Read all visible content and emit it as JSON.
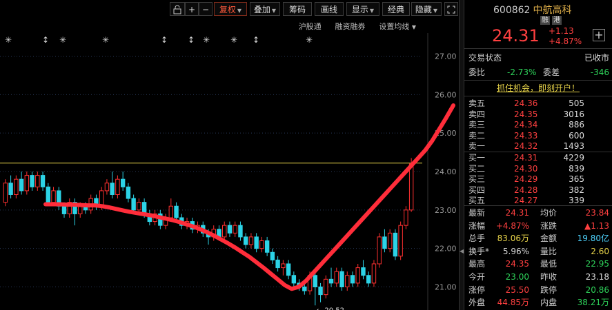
{
  "toolbar": {
    "lock_icon": "lock-icon",
    "zoom_in": "+",
    "zoom_out": "−",
    "fuquan": "复权",
    "diejia": "叠加",
    "chouma": "筹码",
    "huaxian": "画线",
    "xianshi": "显示",
    "jingdian": "经典",
    "yincang": "隐藏",
    "fullscreen_icon": "fullscreen-icon"
  },
  "subbar": {
    "hgt": "沪股通",
    "rzrq": "融资融券",
    "settings": "设置均线"
  },
  "chart_data": {
    "type": "candlestick",
    "y_axis_ticks": [
      "27.00",
      "26.00",
      "25.00",
      "24.00",
      "23.00",
      "22.00",
      "21.00"
    ],
    "ylim": [
      20.4,
      27.6
    ],
    "ref_line": 24.22,
    "low_marker": "20.52",
    "event_marker_types": [
      "star",
      "arrow",
      "star",
      "star",
      "arrow",
      "arrow",
      "star",
      "star",
      "arrow",
      "star"
    ],
    "candles": [
      {
        "o": 23.2,
        "c": 23.7,
        "h": 23.8,
        "l": 23.1
      },
      {
        "o": 23.7,
        "c": 23.4,
        "h": 23.9,
        "l": 23.3
      },
      {
        "o": 23.4,
        "c": 23.8,
        "h": 23.9,
        "l": 23.3
      },
      {
        "o": 23.8,
        "c": 23.5,
        "h": 24.0,
        "l": 23.4
      },
      {
        "o": 23.5,
        "c": 23.9,
        "h": 24.0,
        "l": 23.4
      },
      {
        "o": 23.9,
        "c": 23.6,
        "h": 24.0,
        "l": 23.5
      },
      {
        "o": 23.6,
        "c": 23.9,
        "h": 24.0,
        "l": 23.5
      },
      {
        "o": 23.9,
        "c": 23.6,
        "h": 24.0,
        "l": 23.5
      },
      {
        "o": 23.6,
        "c": 23.2,
        "h": 23.7,
        "l": 23.1
      },
      {
        "o": 23.2,
        "c": 23.5,
        "h": 23.6,
        "l": 23.1
      },
      {
        "o": 23.5,
        "c": 23.1,
        "h": 23.6,
        "l": 23.0
      },
      {
        "o": 23.1,
        "c": 22.9,
        "h": 23.2,
        "l": 22.8
      },
      {
        "o": 22.9,
        "c": 23.2,
        "h": 23.3,
        "l": 22.8
      },
      {
        "o": 23.2,
        "c": 22.9,
        "h": 23.3,
        "l": 22.6
      },
      {
        "o": 22.9,
        "c": 23.1,
        "h": 23.2,
        "l": 22.8
      },
      {
        "o": 23.1,
        "c": 23.0,
        "h": 23.2,
        "l": 22.9
      },
      {
        "o": 23.0,
        "c": 23.3,
        "h": 23.4,
        "l": 22.9
      },
      {
        "o": 23.3,
        "c": 23.1,
        "h": 23.4,
        "l": 23.0
      },
      {
        "o": 23.1,
        "c": 23.5,
        "h": 23.6,
        "l": 23.0
      },
      {
        "o": 23.5,
        "c": 23.7,
        "h": 23.8,
        "l": 23.4
      },
      {
        "o": 23.7,
        "c": 23.4,
        "h": 24.0,
        "l": 23.3
      },
      {
        "o": 23.4,
        "c": 23.8,
        "h": 23.9,
        "l": 23.3
      },
      {
        "o": 23.8,
        "c": 23.6,
        "h": 24.0,
        "l": 23.5
      },
      {
        "o": 23.6,
        "c": 23.3,
        "h": 23.7,
        "l": 23.2
      },
      {
        "o": 23.3,
        "c": 23.0,
        "h": 23.4,
        "l": 22.9
      },
      {
        "o": 23.0,
        "c": 23.2,
        "h": 23.3,
        "l": 22.9
      },
      {
        "o": 23.2,
        "c": 22.9,
        "h": 23.3,
        "l": 22.8
      },
      {
        "o": 22.9,
        "c": 22.7,
        "h": 23.0,
        "l": 22.6
      },
      {
        "o": 22.7,
        "c": 22.9,
        "h": 23.0,
        "l": 22.6
      },
      {
        "o": 22.9,
        "c": 22.6,
        "h": 23.0,
        "l": 22.5
      },
      {
        "o": 22.6,
        "c": 22.8,
        "h": 22.9,
        "l": 22.5
      },
      {
        "o": 22.8,
        "c": 23.1,
        "h": 23.3,
        "l": 22.7
      },
      {
        "o": 23.1,
        "c": 22.8,
        "h": 23.2,
        "l": 22.7
      },
      {
        "o": 22.8,
        "c": 22.6,
        "h": 22.9,
        "l": 22.5
      },
      {
        "o": 22.6,
        "c": 22.7,
        "h": 22.8,
        "l": 22.5
      },
      {
        "o": 22.7,
        "c": 22.5,
        "h": 22.8,
        "l": 22.4
      },
      {
        "o": 22.5,
        "c": 22.6,
        "h": 22.7,
        "l": 22.4
      },
      {
        "o": 22.6,
        "c": 22.4,
        "h": 22.7,
        "l": 22.3
      },
      {
        "o": 22.4,
        "c": 22.3,
        "h": 22.5,
        "l": 22.1
      },
      {
        "o": 22.3,
        "c": 22.5,
        "h": 22.6,
        "l": 22.2
      },
      {
        "o": 22.5,
        "c": 22.3,
        "h": 22.6,
        "l": 22.2
      },
      {
        "o": 22.3,
        "c": 22.6,
        "h": 22.7,
        "l": 22.2
      },
      {
        "o": 22.6,
        "c": 22.4,
        "h": 22.7,
        "l": 22.3
      },
      {
        "o": 22.4,
        "c": 22.6,
        "h": 22.7,
        "l": 22.3
      },
      {
        "o": 22.6,
        "c": 22.3,
        "h": 22.7,
        "l": 22.2
      },
      {
        "o": 22.3,
        "c": 22.1,
        "h": 22.4,
        "l": 22.0
      },
      {
        "o": 22.1,
        "c": 22.3,
        "h": 22.4,
        "l": 22.0
      },
      {
        "o": 22.3,
        "c": 22.0,
        "h": 22.4,
        "l": 21.9
      },
      {
        "o": 22.0,
        "c": 22.2,
        "h": 22.3,
        "l": 21.9
      },
      {
        "o": 22.2,
        "c": 21.9,
        "h": 22.3,
        "l": 21.8
      },
      {
        "o": 21.9,
        "c": 21.7,
        "h": 22.0,
        "l": 21.6
      },
      {
        "o": 21.7,
        "c": 21.5,
        "h": 21.8,
        "l": 21.4
      },
      {
        "o": 21.5,
        "c": 21.6,
        "h": 21.7,
        "l": 21.3
      },
      {
        "o": 21.6,
        "c": 21.3,
        "h": 21.7,
        "l": 21.2
      },
      {
        "o": 21.3,
        "c": 21.1,
        "h": 21.4,
        "l": 21.0
      },
      {
        "o": 21.1,
        "c": 21.0,
        "h": 21.2,
        "l": 20.9
      },
      {
        "o": 21.0,
        "c": 20.9,
        "h": 21.1,
        "l": 20.8
      },
      {
        "o": 20.9,
        "c": 21.3,
        "h": 21.4,
        "l": 20.8
      },
      {
        "o": 21.3,
        "c": 21.0,
        "h": 21.4,
        "l": 20.52
      },
      {
        "o": 21.0,
        "c": 20.8,
        "h": 21.1,
        "l": 20.6
      },
      {
        "o": 20.8,
        "c": 21.2,
        "h": 21.3,
        "l": 20.7
      },
      {
        "o": 21.2,
        "c": 21.1,
        "h": 21.5,
        "l": 21.0
      },
      {
        "o": 21.1,
        "c": 21.4,
        "h": 21.5,
        "l": 21.0
      },
      {
        "o": 21.4,
        "c": 21.0,
        "h": 21.5,
        "l": 20.9
      },
      {
        "o": 21.0,
        "c": 21.3,
        "h": 21.4,
        "l": 20.9
      },
      {
        "o": 21.3,
        "c": 21.1,
        "h": 21.4,
        "l": 21.0
      },
      {
        "o": 21.1,
        "c": 21.5,
        "h": 21.6,
        "l": 21.0
      },
      {
        "o": 21.5,
        "c": 21.3,
        "h": 21.7,
        "l": 21.2
      },
      {
        "o": 21.3,
        "c": 21.1,
        "h": 21.4,
        "l": 21.0
      },
      {
        "o": 21.1,
        "c": 21.6,
        "h": 21.7,
        "l": 21.0
      },
      {
        "o": 21.6,
        "c": 22.3,
        "h": 22.4,
        "l": 21.5
      },
      {
        "o": 22.3,
        "c": 22.0,
        "h": 22.5,
        "l": 21.9
      },
      {
        "o": 22.0,
        "c": 22.4,
        "h": 22.5,
        "l": 21.9
      },
      {
        "o": 22.4,
        "c": 21.8,
        "h": 22.5,
        "l": 21.7
      },
      {
        "o": 21.8,
        "c": 22.6,
        "h": 22.7,
        "l": 21.7
      },
      {
        "o": 22.6,
        "c": 23.0,
        "h": 23.1,
        "l": 22.5
      },
      {
        "o": 23.0,
        "c": 24.2,
        "h": 24.35,
        "l": 22.95
      }
    ],
    "ma_line": [
      23.15,
      23.15,
      23.15,
      23.14,
      23.14,
      23.13,
      23.12,
      23.12,
      23.1,
      23.07,
      23.03,
      22.99,
      22.95,
      22.92,
      22.89,
      22.86,
      22.82,
      22.78,
      22.74,
      22.69,
      22.63,
      22.57,
      22.5,
      22.42,
      22.33,
      22.23,
      22.13,
      22.02,
      21.9,
      21.78,
      21.64,
      21.5,
      21.35,
      21.2,
      21.05,
      20.95,
      21.0,
      21.15,
      21.35,
      21.55,
      21.75,
      21.95,
      22.15,
      22.35,
      22.55,
      22.75,
      22.95,
      23.15,
      23.35,
      23.55,
      23.75,
      23.95,
      24.15,
      24.35,
      24.55,
      24.8,
      25.1,
      25.4,
      25.72
    ]
  },
  "panel": {
    "code": "600862",
    "name": "中航高科",
    "badge1": "融",
    "badge2": "港",
    "plus": "+",
    "price": "24.31",
    "change": "+1.13",
    "change_pct": "+4.87%",
    "trade_status_label": "交易状态",
    "trade_status": "已收市",
    "weibi_label": "委比",
    "weibi": "-2.73%",
    "weicha_label": "委差",
    "weicha": "-346",
    "promo": "抓住机会，即刻开户！",
    "sells": [
      {
        "label": "卖五",
        "price": "24.36",
        "vol": "505"
      },
      {
        "label": "卖四",
        "price": "24.35",
        "vol": "3016"
      },
      {
        "label": "卖三",
        "price": "24.34",
        "vol": "886"
      },
      {
        "label": "卖二",
        "price": "24.33",
        "vol": "600"
      },
      {
        "label": "卖一",
        "price": "24.32",
        "vol": "1493"
      }
    ],
    "buys": [
      {
        "label": "买一",
        "price": "24.31",
        "vol": "4229"
      },
      {
        "label": "买二",
        "price": "24.30",
        "vol": "839"
      },
      {
        "label": "买三",
        "price": "24.29",
        "vol": "365"
      },
      {
        "label": "买四",
        "price": "24.28",
        "vol": "382"
      },
      {
        "label": "买五",
        "price": "24.27",
        "vol": "339"
      }
    ],
    "stats": [
      {
        "l1": "最新",
        "v1": "24.31",
        "c1": "red",
        "l2": "均价",
        "v2": "23.84",
        "c2": "red"
      },
      {
        "l1": "涨幅",
        "v1": "+4.87%",
        "c1": "red",
        "l2": "涨跌",
        "v2": "▲1.13",
        "c2": "red"
      },
      {
        "l1": "总手",
        "v1": "83.06万",
        "c1": "yellow",
        "l2": "金额",
        "v2": "19.80亿",
        "c2": "cyan"
      },
      {
        "l1": "换手*",
        "v1": "5.96%",
        "c1": "white",
        "l2": "量比",
        "v2": "2.60",
        "c2": "yellow"
      },
      {
        "l1": "最高",
        "v1": "24.35",
        "c1": "red",
        "l2": "最低",
        "v2": "22.95",
        "c2": "green"
      },
      {
        "l1": "今开",
        "v1": "23.00",
        "c1": "green",
        "l2": "昨收",
        "v2": "23.18",
        "c2": "white"
      },
      {
        "l1": "涨停",
        "v1": "25.50",
        "c1": "red",
        "l2": "跌停",
        "v2": "20.86",
        "c2": "green"
      },
      {
        "l1": "外盘",
        "v1": "44.85万",
        "c1": "red",
        "l2": "内盘",
        "v2": "38.21万",
        "c2": "green"
      }
    ]
  },
  "colors": {
    "up": "#ff3030",
    "down": "#2cd3e6",
    "ma": "#ff2d3a",
    "ref": "#e8d44a"
  }
}
